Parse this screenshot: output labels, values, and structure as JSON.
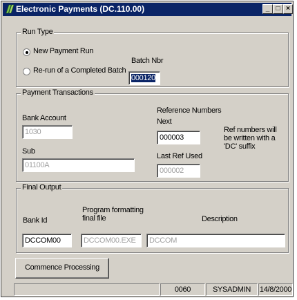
{
  "window": {
    "title": "Electronic Payments (DC.110.00)"
  },
  "title_buttons": {
    "minimize": "_",
    "maximize": "□",
    "close": "×"
  },
  "run_type": {
    "legend": "Run Type",
    "new_payment_run": "New Payment Run",
    "rerun_completed_batch": "Re-run of a Completed Batch",
    "selected": "new_payment_run",
    "batch_nbr_label": "Batch Nbr",
    "batch_nbr_value": "000120"
  },
  "payment_transactions": {
    "legend": "Payment Transactions",
    "bank_account_label": "Bank Account",
    "bank_account_value": "1030",
    "sub_label": "Sub",
    "sub_value": "01100A",
    "reference_numbers_label": "Reference Numbers",
    "next_label": "Next",
    "next_value": "000003",
    "last_ref_used_label": "Last Ref Used",
    "last_ref_used_value": "000002",
    "note": "Ref numbers will be written with a 'DC' suffix"
  },
  "final_output": {
    "legend": "Final Output",
    "bank_id_label": "Bank Id",
    "bank_id_value": "DCCOM00",
    "program_label": "Program formatting final file",
    "program_value": "DCCOM00.EXE",
    "description_label": "Description",
    "description_value": "DCCOM"
  },
  "commence_button": "Commence Processing",
  "status_bar": {
    "field1": "",
    "code": "0060",
    "user": "SYSADMIN",
    "date": "14/8/2000"
  },
  "colors": {
    "titlebar": "#0a2466",
    "face": "#d4d0c8"
  },
  "icons": {
    "app": "green-leaf-icon"
  }
}
